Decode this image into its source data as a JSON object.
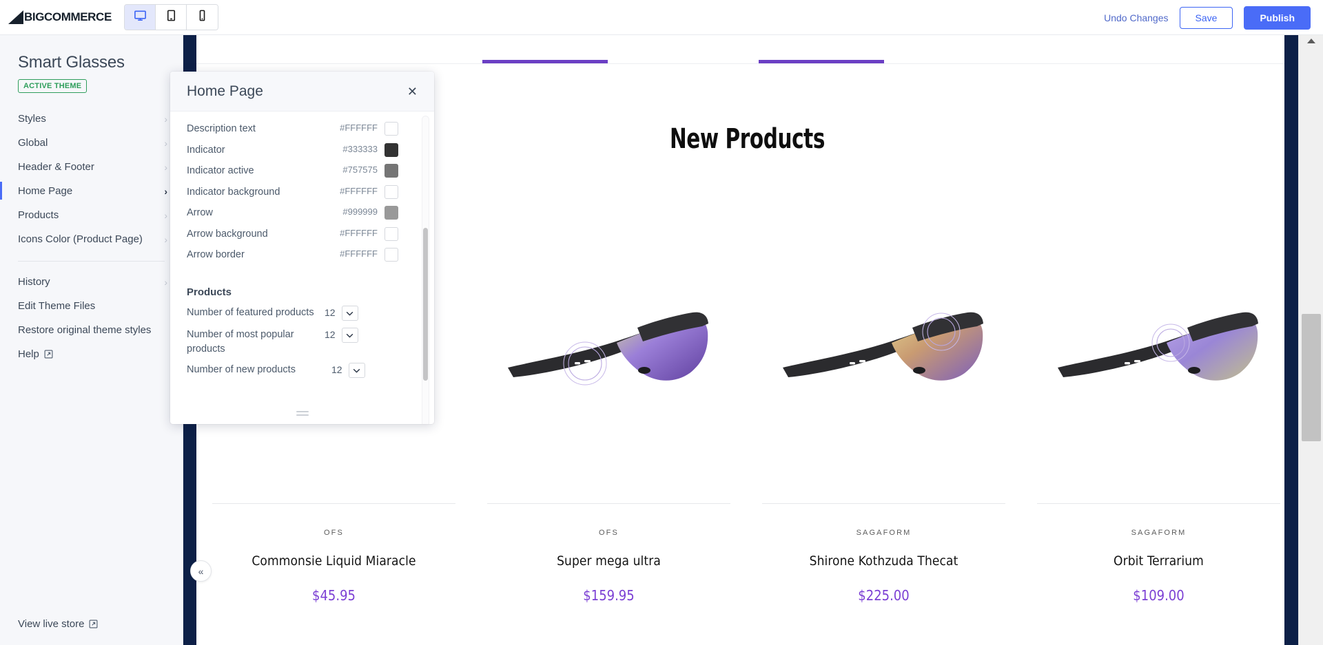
{
  "topbar": {
    "brand_name": "BIGCOMMERCE",
    "brand_big": "BIG",
    "brand_commerce": "COMMERCE",
    "devices": [
      {
        "name": "desktop-view-button",
        "icon": "desktop-icon",
        "active": true
      },
      {
        "name": "tablet-view-button",
        "icon": "tablet-icon",
        "active": false
      },
      {
        "name": "mobile-view-button",
        "icon": "mobile-icon",
        "active": false
      }
    ],
    "undo_label": "Undo Changes",
    "save_label": "Save",
    "publish_label": "Publish"
  },
  "sidebar": {
    "theme_name": "Smart Glasses",
    "badge": "ACTIVE THEME",
    "items": [
      {
        "label": "Styles",
        "current": false
      },
      {
        "label": "Global",
        "current": false
      },
      {
        "label": "Header & Footer",
        "current": false
      },
      {
        "label": "Home Page",
        "current": true
      },
      {
        "label": "Products",
        "current": false
      },
      {
        "label": "Icons Color (Product Page)",
        "current": false
      }
    ],
    "secondary": [
      {
        "label": "History",
        "chevron": true
      },
      {
        "label": "Edit Theme Files",
        "chevron": false
      },
      {
        "label": "Restore original theme styles",
        "chevron": false
      },
      {
        "label": "Help",
        "chevron": false,
        "external": true
      }
    ],
    "view_live_store": "View live store",
    "chevron_glyph": "›"
  },
  "modal": {
    "title": "Home Page",
    "close_glyph": "✕",
    "color_rows": [
      {
        "label": "Description text",
        "value": "#FFFFFF"
      },
      {
        "label": "Indicator",
        "value": "#333333"
      },
      {
        "label": "Indicator active",
        "value": "#757575"
      },
      {
        "label": "Indicator background",
        "value": "#FFFFFF"
      },
      {
        "label": "Arrow",
        "value": "#999999"
      },
      {
        "label": "Arrow background",
        "value": "#FFFFFF"
      },
      {
        "label": "Arrow border",
        "value": "#FFFFFF"
      }
    ],
    "products_section_label": "Products",
    "number_rows": [
      {
        "label": "Number of featured products",
        "value": "12"
      },
      {
        "label": "Number of most popular products",
        "value": "12"
      },
      {
        "label": "Number of new products",
        "value": "12"
      }
    ]
  },
  "preview": {
    "section_title": "New Products",
    "collapse_glyph": "«",
    "accent_color": "#6B3FC4",
    "price_color": "#7B3FD4",
    "products": [
      {
        "brand": "OFS",
        "name": "Commonsie Liquid Miaracle",
        "price": "$45.95"
      },
      {
        "brand": "OFS",
        "name": "Super mega ultra",
        "price": "$159.95"
      },
      {
        "brand": "SAGAFORM",
        "name": "Shirone Kothzuda Thecat",
        "price": "$225.00"
      },
      {
        "brand": "SAGAFORM",
        "name": "Orbit Terrarium",
        "price": "$109.00"
      }
    ]
  }
}
